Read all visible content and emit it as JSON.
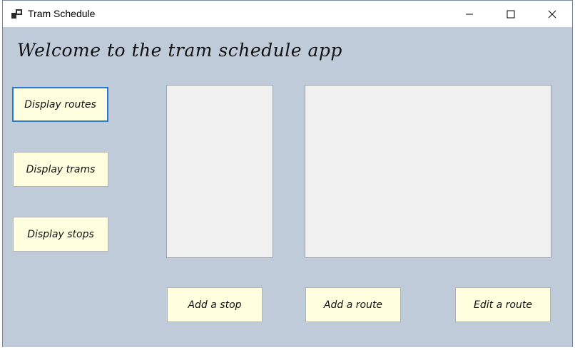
{
  "window": {
    "title": "Tram Schedule",
    "icon": "app-window-icon"
  },
  "header": {
    "welcome": "Welcome to the tram schedule app"
  },
  "sidebar": {
    "buttons": [
      {
        "label": "Display routes"
      },
      {
        "label": "Display trams"
      },
      {
        "label": "Display stops"
      }
    ]
  },
  "actions": {
    "add_stop": "Add a stop",
    "add_route": "Add a route",
    "edit_route": "Edit a route"
  },
  "colors": {
    "background": "#bfcbd9",
    "button": "#ffffdf",
    "focus_border": "#2a7ad2",
    "list_background": "#f0f0f0"
  }
}
